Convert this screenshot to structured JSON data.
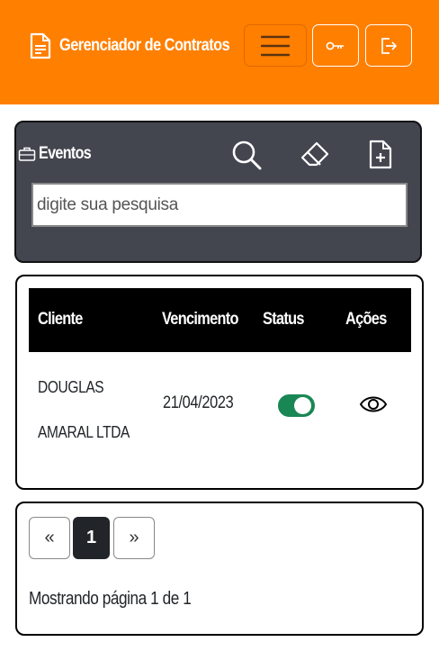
{
  "header": {
    "title": "Gerenciador de Contratos",
    "accent_color": "#ff7f00",
    "icons": [
      "document-icon",
      "hamburger-menu-icon",
      "key-icon",
      "logout-icon"
    ]
  },
  "events_panel": {
    "title": "Eventos",
    "search_placeholder": "digite sua pesquisa",
    "icons": [
      "briefcase-icon",
      "search-icon",
      "eraser-icon",
      "new-document-icon"
    ]
  },
  "table": {
    "headers": [
      "Cliente",
      "Vencimento",
      "Status",
      "Ações"
    ],
    "rows": [
      {
        "cliente": "DOUGLAS AMARAL LTDA",
        "vencimento": "21/04/2023",
        "status_active": true,
        "action_icon": "eye-icon"
      }
    ]
  },
  "pagination": {
    "prev_label": "«",
    "current_page": "1",
    "next_label": "»",
    "info": "Mostrando página 1 de 1"
  }
}
